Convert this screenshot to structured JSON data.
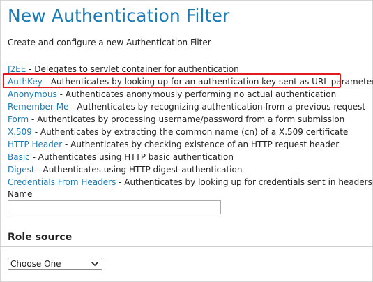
{
  "page": {
    "title": "New Authentication Filter",
    "subtitle": "Create and configure a new Authentication Filter"
  },
  "filters": [
    {
      "name": "J2EE",
      "desc": " - Delegates to servlet container for authentication"
    },
    {
      "name": "AuthKey",
      "desc": " - Authenticates by looking up for an authentication key sent as URL parameter"
    },
    {
      "name": "Anonymous",
      "desc": " - Authenticates anonymously performing no actual authentication"
    },
    {
      "name": "Remember Me",
      "desc": " - Authenticates by recognizing authentication from a previous request"
    },
    {
      "name": "Form",
      "desc": " - Authenticates by processing username/password from a form submission"
    },
    {
      "name": "X.509",
      "desc": " - Authenticates by extracting the common name (cn) of a X.509 certificate"
    },
    {
      "name": "HTTP Header",
      "desc": " - Authenticates by checking existence of an HTTP request header"
    },
    {
      "name": "Basic",
      "desc": " - Authenticates using HTTP basic authentication"
    },
    {
      "name": "Digest",
      "desc": " - Authenticates using HTTP digest authentication"
    },
    {
      "name": "Credentials From Headers",
      "desc": " - Authenticates by looking up for credentials sent in headers"
    }
  ],
  "name_field": {
    "label": "Name",
    "value": ""
  },
  "role_source": {
    "title": "Role source",
    "selected": "Choose One"
  },
  "colors": {
    "link": "#1b7bb5",
    "highlight": "#e01b1b"
  },
  "icons": {
    "select_arrow": "chevron-down-icon"
  }
}
